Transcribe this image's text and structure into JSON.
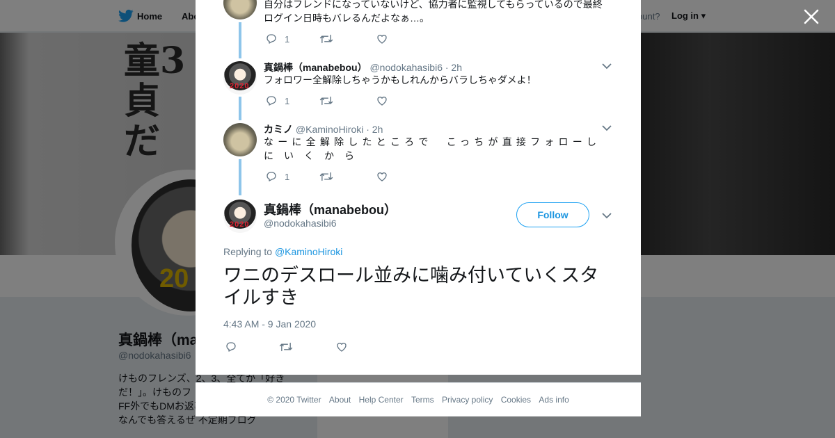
{
  "nav": {
    "home": "Home",
    "about": "Abo",
    "account_prompt": "ccount?",
    "login": "Log in"
  },
  "banner_text": "童3\n貞\nだ",
  "background_profile": {
    "name": "真鍋棒（ma",
    "handle": "@nodokahasibi6",
    "bio": "けものフレンズ、2、3、全てが「好き だ！」。けものフ コウ推し、仮面ラ き。FF外でもDMお返事するよ！聞かれ たらなんでも答えるぜ 不定期ブログ",
    "avatar_number": "20"
  },
  "thread": [
    {
      "name": "",
      "handle": "",
      "time": "",
      "text": "自分はフレンドになっていないけど、協力者に監視してもらっているので最終ログイン日時もバレるんだよなぁ…。",
      "reply_count": "1",
      "avatar": "kamino-avatar"
    },
    {
      "name": "真鍋棒（manabebou）",
      "handle": "@nodokahasibi6",
      "time": "· 2h",
      "text": "フォロワー全解除しちゃうかもしれんからバラしちゃダメよ！",
      "reply_count": "1",
      "avatar": "manabebou-avatar"
    },
    {
      "name": "カミノ",
      "handle": "@KaminoHiroki",
      "time": "· 2h",
      "text_line1": "なーに全解除したところで　こっちが直接フォローし",
      "text_line2": "にいくから",
      "reply_count": "1",
      "avatar": "kamino-avatar"
    }
  ],
  "main_tweet": {
    "name": "真鍋棒（manabebou）",
    "handle": "@nodokahasibi6",
    "follow_label": "Follow",
    "replying_prefix": "Replying to",
    "replying_to": "@KaminoHiroki",
    "text": "ワニのデスロール並みに噛み付いていくスタイルすき",
    "timestamp": "4:43 AM - 9 Jan 2020",
    "avatar_number": "2020"
  },
  "footer": [
    "© 2020 Twitter",
    "About",
    "Help Center",
    "Terms",
    "Privacy policy",
    "Cookies",
    "Ads info"
  ],
  "colors": {
    "accent": "#1da1f2",
    "link": "#1b95e0",
    "thread_line": "#8ec5ea",
    "muted": "#657786"
  },
  "icons": [
    "twitter-bird-icon",
    "close-icon",
    "reply-icon",
    "retweet-icon",
    "like-icon",
    "chevron-down-icon"
  ]
}
